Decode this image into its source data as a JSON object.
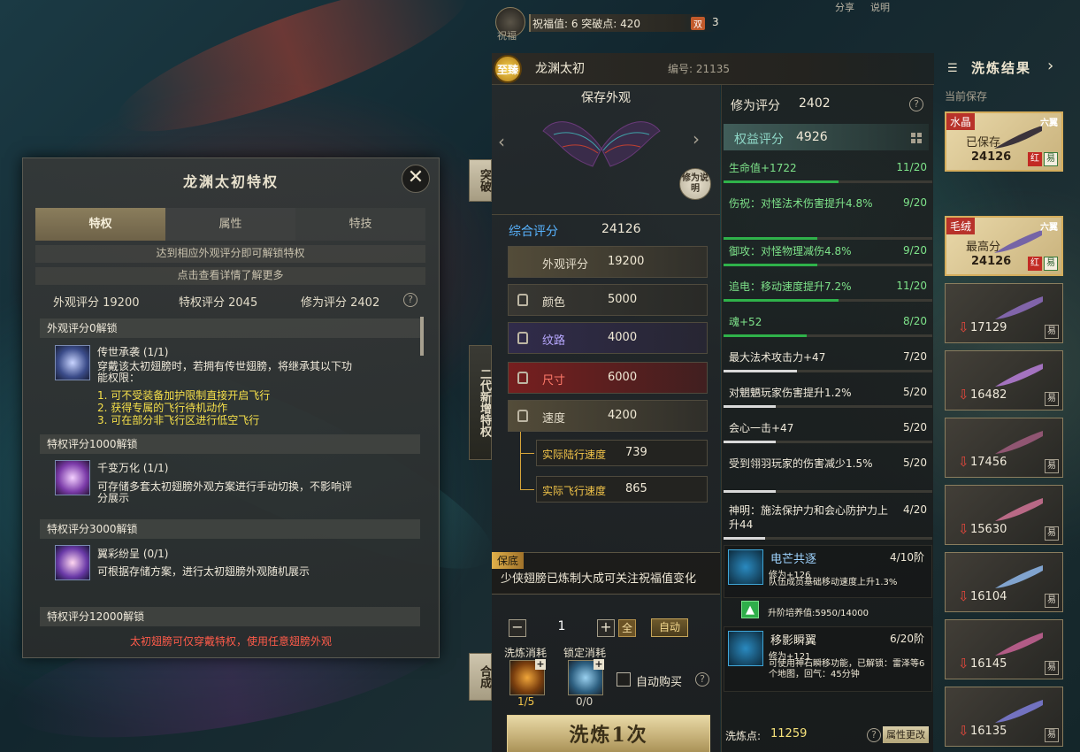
{
  "topbar": {
    "bless_caption": "祝福",
    "bless_text": "祝福值: 6   突破点: 420",
    "double_badge": "双",
    "double_count": "3",
    "share": "分享",
    "explain": "说明"
  },
  "wing": {
    "rank_badge": "至臻",
    "name": "龙渊太初",
    "code": "编号: 21135"
  },
  "preview": {
    "save_look": "保存外观",
    "repair_button": "修为说明",
    "total_label": "综合评分",
    "total_value": "24126",
    "look_score_label": "外观评分",
    "look_score_value": "19200",
    "color_label": "颜色",
    "color_value": "5000",
    "pattern_label": "纹路",
    "pattern_value": "4000",
    "size_label": "尺寸",
    "size_value": "6000",
    "speed_label": "速度",
    "speed_value": "4200",
    "land_speed_label": "实际陆行速度",
    "land_speed_value": "739",
    "fly_speed_label": "实际飞行速度",
    "fly_speed_value": "865"
  },
  "side_tabs": {
    "breakthrough": "突破",
    "second_gen": "二代新增特权",
    "merge": "合成"
  },
  "protect": {
    "tag": "保底",
    "text": "少侠翅膀已炼制大成可关注祝福值变化"
  },
  "refine_controls": {
    "minus": "−",
    "quantity": "1",
    "plus": "+",
    "all": "全",
    "auto": "自动",
    "refine_cost_label": "洗炼消耗",
    "lock_cost_label": "锁定消耗",
    "refine_cost_count": "1/5",
    "lock_cost_count": "0/0",
    "auto_buy": "自动购买",
    "refine_button": "洗炼1次"
  },
  "stats": {
    "cultivation_label": "修为评分",
    "cultivation_value": "2402",
    "equity_label": "权益评分",
    "equity_value": "4926",
    "attributes": [
      {
        "text": "生命值+1722",
        "count": "11/20",
        "fill": 0.55,
        "green": true
      },
      {
        "text": "伤祝：对怪法术伤害提升4.8%",
        "count": "9/20",
        "fill": 0.45,
        "green": true
      },
      {
        "text": "御攻：对怪物理减伤4.8%",
        "count": "9/20",
        "fill": 0.45,
        "green": true
      },
      {
        "text": "追电：移动速度提升7.2%",
        "count": "11/20",
        "fill": 0.55,
        "green": true
      },
      {
        "text": "魂+52",
        "count": "8/20",
        "fill": 0.4,
        "green": true
      },
      {
        "text": "最大法术攻击力+47",
        "count": "7/20",
        "fill": 0.35,
        "green": false
      },
      {
        "text": "对魍魉玩家伤害提升1.2%",
        "count": "5/20",
        "fill": 0.25,
        "green": false
      },
      {
        "text": "会心一击+47",
        "count": "5/20",
        "fill": 0.25,
        "green": false
      },
      {
        "text": "受到翎羽玩家的伤害减少1.5%",
        "count": "5/20",
        "fill": 0.25,
        "green": false
      },
      {
        "text": "神明：施法保护力和会心防护力上升44",
        "count": "4/20",
        "fill": 0.2,
        "green": false
      }
    ],
    "skill1": {
      "name": "电芒共逐",
      "level": "4/10阶",
      "line1": "修为+126",
      "line2": "队伍成员基础移动速度上升1.3%"
    },
    "upgrade_text": "升阶培养值:5950/14000",
    "skill2": {
      "name": "移影瞬翼",
      "level": "6/20阶",
      "line1": "修为+121",
      "line2": "可使用神石瞬移功能，已解锁：雷泽等6个地图，回气：45分钟"
    },
    "refine_points_label": "洗炼点:",
    "refine_points_value": "11259",
    "attr_change_button": "属性更改"
  },
  "results": {
    "title": "洗炼结果",
    "current_save": "当前保存",
    "cards": [
      {
        "tag": "水晶",
        "grade": "六翼",
        "status": "已保存",
        "score": "24126",
        "gold": true
      },
      {
        "tag": "毛绒",
        "grade": "六翼",
        "status": "最高分",
        "score": "24126",
        "gold": true
      },
      {
        "score": "17129"
      },
      {
        "score": "16482"
      },
      {
        "score": "17456"
      },
      {
        "score": "15630"
      },
      {
        "score": "16104"
      },
      {
        "score": "16145"
      },
      {
        "score": "16135"
      }
    ],
    "easy_mark": "易",
    "red_mark": "红",
    "down_arrow": "⇩"
  },
  "popup": {
    "title": "龙渊太初特权",
    "close": "✕",
    "tabs": [
      "特权",
      "属性",
      "特技"
    ],
    "note1": "达到相应外观评分即可解锁特权",
    "note2": "点击查看详情了解更多",
    "score_look": "外观评分 19200",
    "score_priv": "特权评分 2045",
    "score_cult": "修为评分 2402",
    "section1": "外观评分0解锁",
    "item1_name": "传世承袭 (1/1)",
    "item1_desc": "穿戴该太初翅膀时，若拥有传世翅膀，将继承其以下功能权限：",
    "item1_p1": "1. 可不受装备加护限制直接开启飞行",
    "item1_p2": "2. 获得专属的飞行待机动作",
    "item1_p3": "3. 可在部分非飞行区进行低空飞行",
    "section2": "特权评分1000解锁",
    "item2_name": "千变万化 (1/1)",
    "item2_desc": "可存储多套太初翅膀外观方案进行手动切换，不影响评分展示",
    "section3": "特权评分3000解锁",
    "item3_name": "翼彩纷呈 (0/1)",
    "item3_desc": "可根据存储方案，进行太初翅膀外观随机展示",
    "section4": "特权评分12000解锁",
    "footer": "太初翅膀可仅穿戴特权，使用任意翅膀外观"
  },
  "colors": {
    "accent_gold": "#d4ad5c",
    "green": "#2fb24a",
    "blue_label": "#58b3ff",
    "warning_red": "#ff5b4a",
    "yellow_text": "#f6e04a"
  }
}
